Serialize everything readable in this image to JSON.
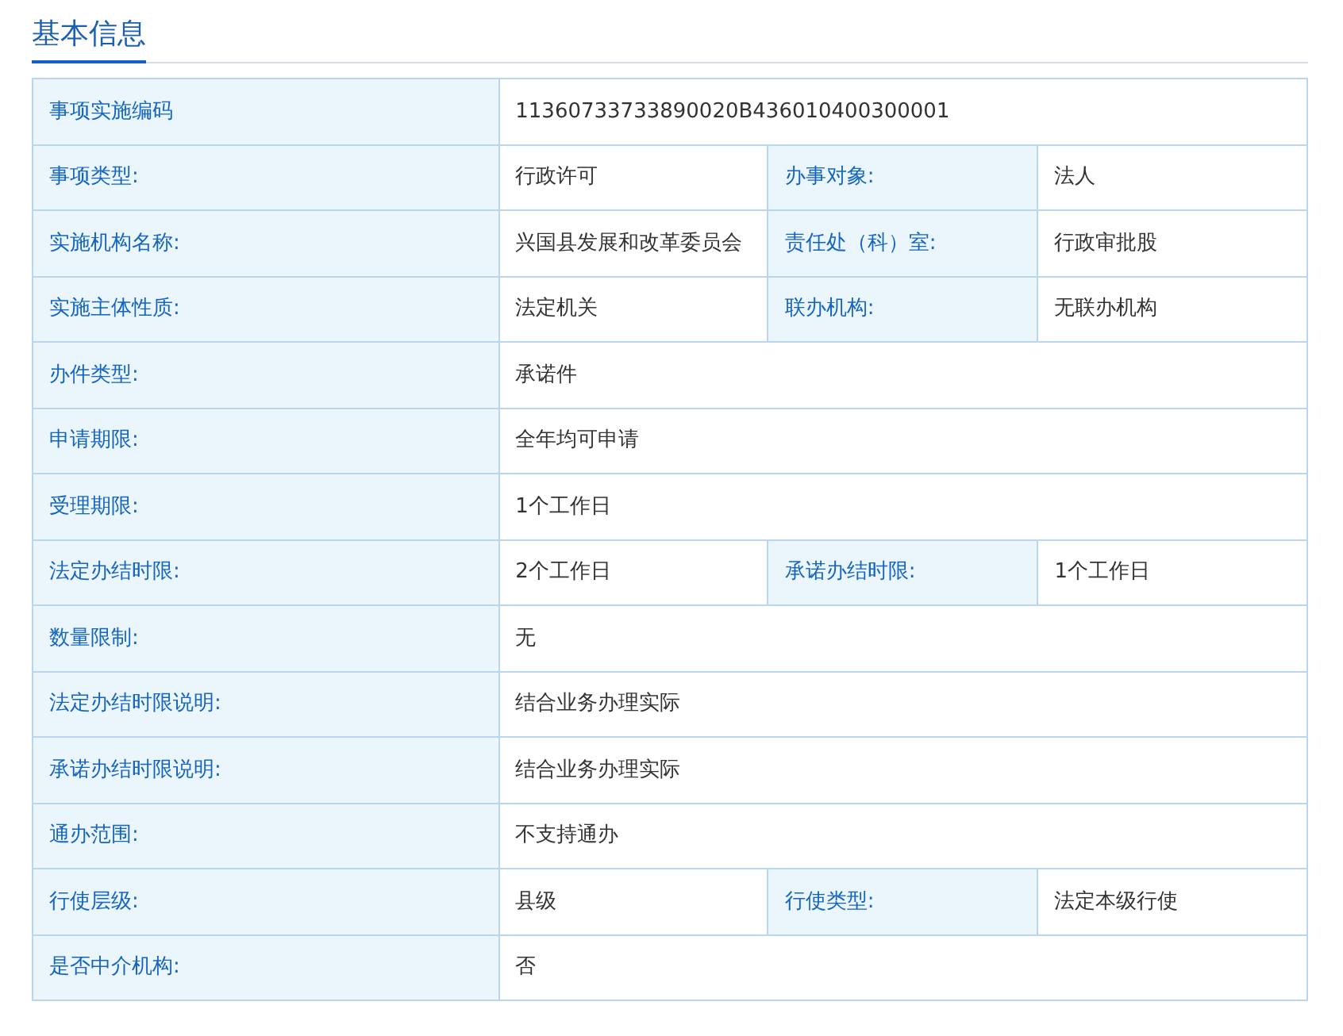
{
  "section_title": "基本信息",
  "rows": [
    {
      "fields": [
        {
          "label": "事项实施编码",
          "value": "11360733733890020B436010400300001"
        }
      ]
    },
    {
      "fields": [
        {
          "label": "事项类型:",
          "value": "行政许可"
        },
        {
          "label": "办事对象:",
          "value": "法人"
        }
      ]
    },
    {
      "fields": [
        {
          "label": "实施机构名称:",
          "value": "兴国县发展和改革委员会"
        },
        {
          "label": "责任处（科）室:",
          "value": "行政审批股"
        }
      ]
    },
    {
      "fields": [
        {
          "label": "实施主体性质:",
          "value": "法定机关"
        },
        {
          "label": "联办机构:",
          "value": "无联办机构"
        }
      ]
    },
    {
      "fields": [
        {
          "label": "办件类型:",
          "value": "承诺件"
        }
      ]
    },
    {
      "fields": [
        {
          "label": "申请期限:",
          "value": "全年均可申请"
        }
      ]
    },
    {
      "fields": [
        {
          "label": "受理期限:",
          "value": "1个工作日"
        }
      ]
    },
    {
      "fields": [
        {
          "label": "法定办结时限:",
          "value": "2个工作日"
        },
        {
          "label": "承诺办结时限:",
          "value": "1个工作日"
        }
      ]
    },
    {
      "fields": [
        {
          "label": "数量限制:",
          "value": "无"
        }
      ]
    },
    {
      "fields": [
        {
          "label": "法定办结时限说明:",
          "value": "结合业务办理实际"
        }
      ]
    },
    {
      "fields": [
        {
          "label": "承诺办结时限说明:",
          "value": "结合业务办理实际"
        }
      ]
    },
    {
      "fields": [
        {
          "label": "通办范围:",
          "value": "不支持通办"
        }
      ]
    },
    {
      "fields": [
        {
          "label": "行使层级:",
          "value": "县级"
        },
        {
          "label": "行使类型:",
          "value": "法定本级行使"
        }
      ]
    },
    {
      "fields": [
        {
          "label": "是否中介机构:",
          "value": "否"
        }
      ]
    }
  ]
}
